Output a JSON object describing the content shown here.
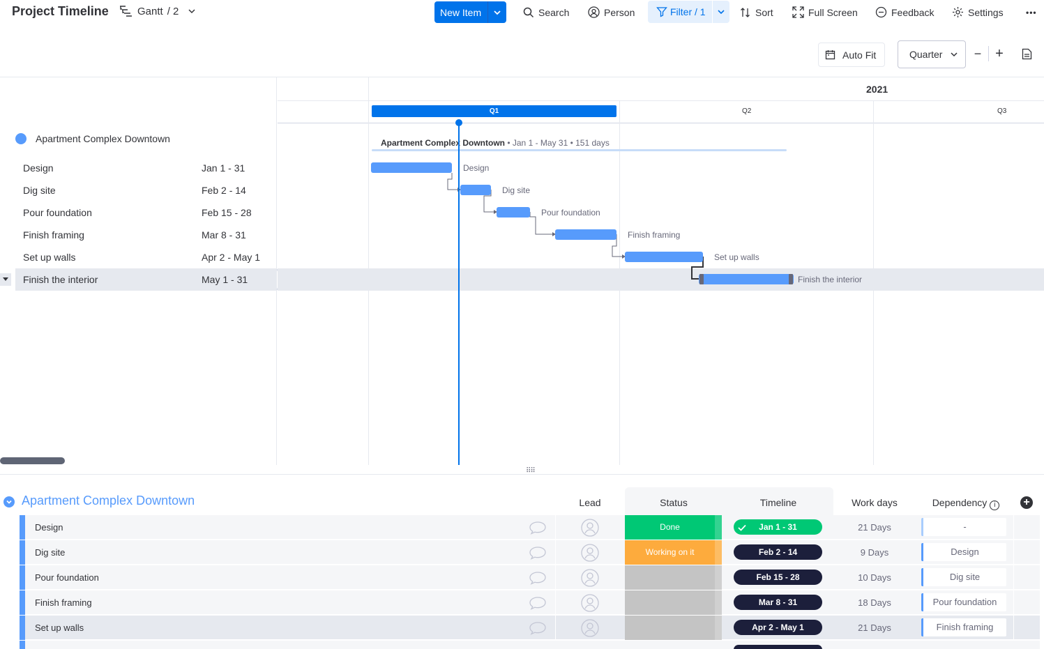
{
  "header": {
    "title": "Project Timeline",
    "view_name": "Gantt",
    "view_count": "/ 2",
    "new_item": "New Item",
    "search": "Search",
    "person": "Person",
    "filter": "Filter / 1",
    "sort": "Sort",
    "full_screen": "Full Screen",
    "feedback": "Feedback",
    "settings": "Settings",
    "more": "•••"
  },
  "zoom": {
    "auto_fit": "Auto Fit",
    "scale": "Quarter",
    "zoom_out": "−",
    "zoom_in": "+"
  },
  "gantt": {
    "group_name": "Apartment Complex Downtown",
    "year": "2021",
    "quarters": [
      "Q1",
      "Q2",
      "Q3"
    ],
    "summary_name": "Apartment Complex Downtown",
    "summary_range": " • Jan 1 - May 31 • 151 days",
    "tasks": [
      {
        "name": "Design",
        "dates": "Jan 1 - 31"
      },
      {
        "name": "Dig site",
        "dates": "Feb 2 - 14"
      },
      {
        "name": "Pour foundation",
        "dates": "Feb 15 - 28"
      },
      {
        "name": "Finish framing",
        "dates": "Mar 8 - 31"
      },
      {
        "name": "Set up walls",
        "dates": "Apr 2 - May 1"
      },
      {
        "name": "Finish the interior",
        "dates": "May 1 - 31"
      }
    ],
    "selected_task_index": 5
  },
  "table": {
    "group_title": "Apartment Complex Downtown",
    "columns": {
      "lead": "Lead",
      "status": "Status",
      "timeline": "Timeline",
      "work_days": "Work days",
      "dependency": "Dependency"
    },
    "add_column": "+",
    "info": "i",
    "rows": [
      {
        "name": "Design",
        "status": "Done",
        "status_color": "#00c875",
        "timeline": "Jan 1 - 31",
        "timeline_done": true,
        "work_days": "21 Days",
        "dependency": "-"
      },
      {
        "name": "Dig site",
        "status": "Working on it",
        "status_color": "#fdab3d",
        "timeline": "Feb 2 - 14",
        "timeline_done": false,
        "work_days": "9 Days",
        "dependency": "Design"
      },
      {
        "name": "Pour foundation",
        "status": "",
        "status_color": "#c4c4c4",
        "timeline": "Feb 15 - 28",
        "timeline_done": false,
        "work_days": "10 Days",
        "dependency": "Dig site"
      },
      {
        "name": "Finish framing",
        "status": "",
        "status_color": "#c4c4c4",
        "timeline": "Mar 8 - 31",
        "timeline_done": false,
        "work_days": "18 Days",
        "dependency": "Pour foundation"
      },
      {
        "name": "Set up walls",
        "status": "",
        "status_color": "#c4c4c4",
        "timeline": "Apr 2 - May 1",
        "timeline_done": false,
        "work_days": "21 Days",
        "dependency": "Finish framing"
      }
    ]
  },
  "colors": {
    "primary": "#0073ea",
    "bar": "#579bfc",
    "done": "#00c875",
    "working": "#fdab3d",
    "empty_status": "#c4c4c4",
    "timeline_pill": "#1c1f3b"
  }
}
